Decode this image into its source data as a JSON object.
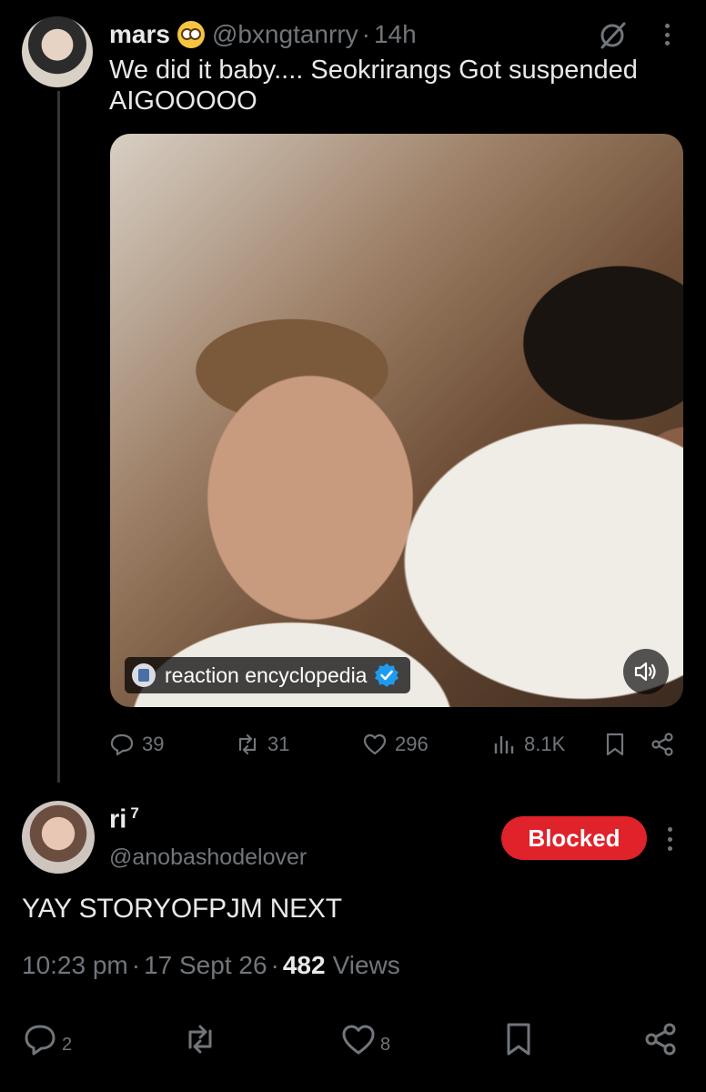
{
  "tweet1": {
    "name": "mars",
    "emoji": "nerd-face",
    "handle": "@bxngtanrry",
    "separator": "·",
    "time": "14h",
    "text": "We did it baby.... Seokrirangs  Got suspended AIGOOOOO",
    "media": {
      "attribution": "reaction encyclopedia",
      "verified": true
    },
    "stats": {
      "replies": "39",
      "retweets": "31",
      "likes": "296",
      "views": "8.1K"
    }
  },
  "tweet2": {
    "name": "ri",
    "name_sup": "7",
    "handle": "@anobashodelover",
    "blocked_label": "Blocked",
    "text": "YAY STORYOFPJM NEXT",
    "time": "10:23 pm",
    "date": "17 Sept 26",
    "dot": "·",
    "views_count": "482",
    "views_label": "Views",
    "stats": {
      "replies": "2",
      "likes": "8"
    }
  },
  "colors": {
    "background": "#000000",
    "text": "#e7e9ea",
    "muted": "#71767b",
    "blocked": "#e0222b",
    "verified": "#1d9bf0"
  }
}
